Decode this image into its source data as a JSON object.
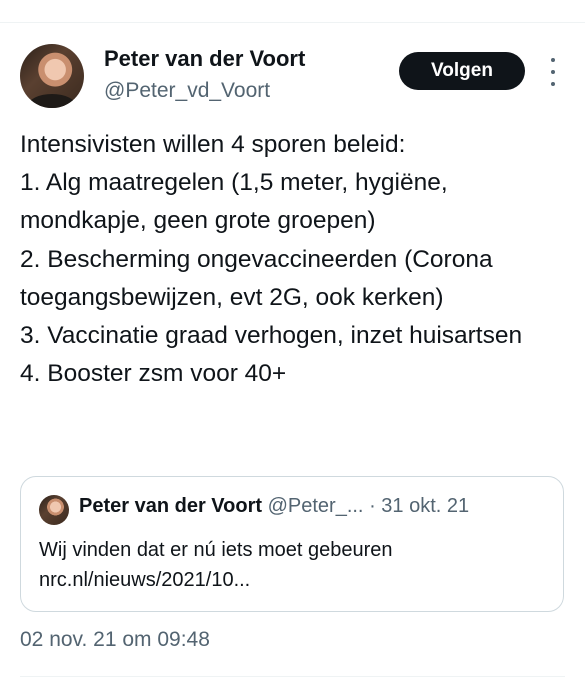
{
  "author": {
    "display_name": "Peter van der Voort",
    "handle": "@Peter_vd_Voort"
  },
  "actions": {
    "follow_label": "Volgen",
    "more_icon": "more-vertical-icon"
  },
  "tweet": {
    "text": "Intensivisten willen 4 sporen beleid:\n1. Alg maatregelen (1,5 meter, hygiëne, mondkapje, geen grote groepen)\n2. Bescherming ongevaccineerden (Corona toegangsbewijzen, evt 2G, ook kerken)\n3. Vaccinatie graad verhogen, inzet huisartsen\n4. Booster zsm voor 40+",
    "timestamp": "02 nov. 21 om 09:48"
  },
  "quoted_tweet": {
    "display_name": "Peter van der Voort",
    "handle": "@Peter_...",
    "separator": "·",
    "date": "31 okt. 21",
    "text": "Wij vinden dat er nú iets moet gebeuren",
    "link": "nrc.nl/nieuws/2021/10..."
  },
  "colors": {
    "text_primary": "#0f1419",
    "text_secondary": "#536471",
    "border": "#cfd9de",
    "follow_bg": "#0f1419"
  }
}
